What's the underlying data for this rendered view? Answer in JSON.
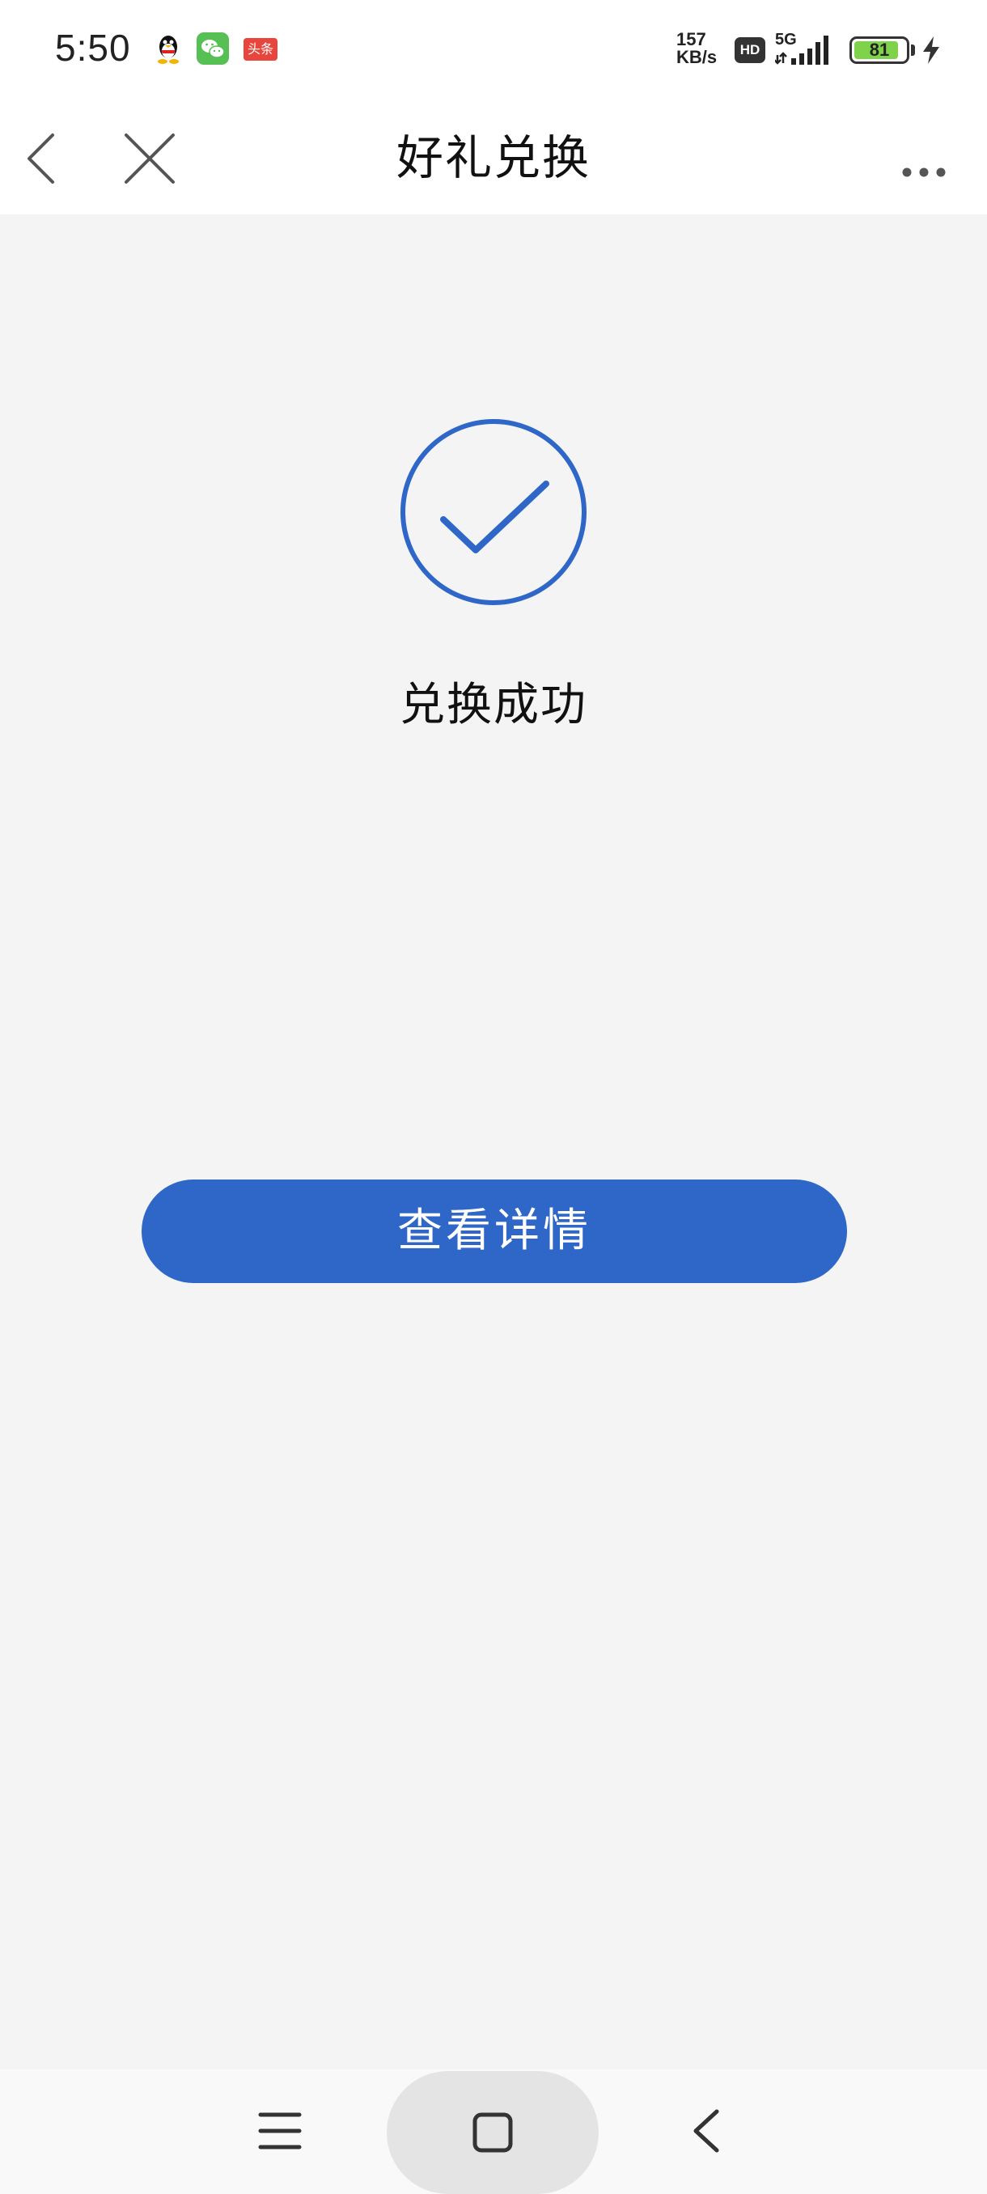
{
  "status_bar": {
    "time": "5:50",
    "net_speed_value": "157",
    "net_speed_unit": "KB/s",
    "hd_label": "HD",
    "network": "5G",
    "battery": "81",
    "notification_icons": [
      "qq-icon",
      "wechat-icon",
      "toutiao-icon"
    ],
    "toutiao_label": "头条"
  },
  "nav": {
    "title": "好礼兑换"
  },
  "result": {
    "message": "兑换成功",
    "icon": "check-circle-icon"
  },
  "actions": {
    "view_details_label": "查看详情"
  },
  "colors": {
    "accent": "#2f67c9",
    "background": "#f4f4f4",
    "battery_fill": "#7ed34b"
  }
}
